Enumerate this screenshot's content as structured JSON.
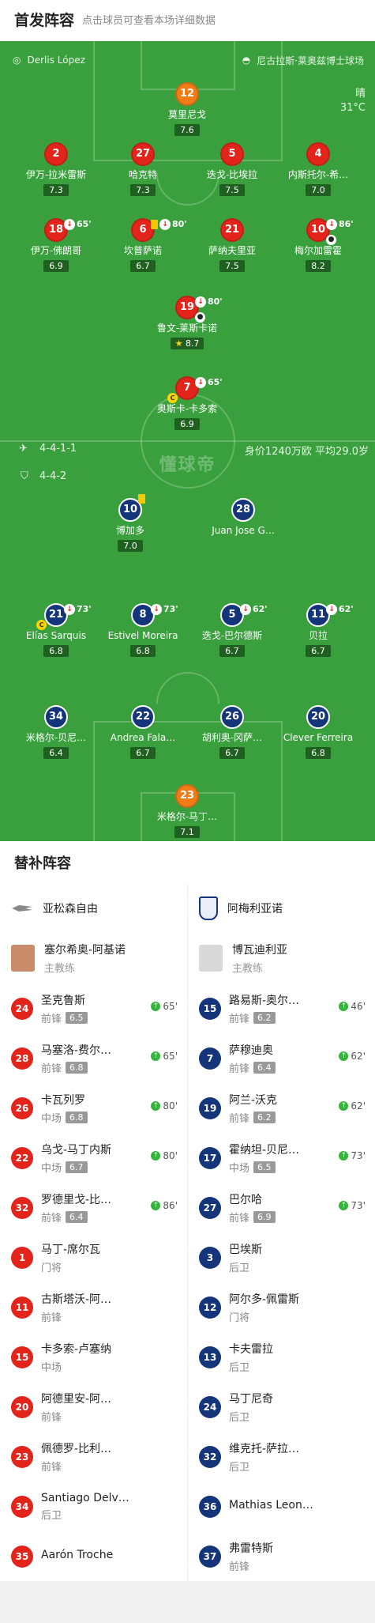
{
  "header": {
    "title": "首发阵容",
    "hint": "点击球员可查看本场详细数据"
  },
  "pitch_meta": {
    "referee": "Derlis López",
    "stadium": "尼古拉斯·莱奥兹博士球场",
    "weather": "晴",
    "temperature": "31°C",
    "home_formation": "4-4-1-1",
    "away_formation": "4-4-2",
    "value_info": "身价1240万欧 平均29.0岁",
    "watermark": "懂球帝"
  },
  "home_players": [
    {
      "num": "12",
      "name": "莫里尼戈",
      "rating": "7.6",
      "color": "orange"
    },
    {
      "num": "2",
      "name": "伊万-拉米雷斯",
      "rating": "7.3",
      "color": "red"
    },
    {
      "num": "27",
      "name": "哈克特",
      "rating": "7.3",
      "color": "red"
    },
    {
      "num": "5",
      "name": "迭戈-比埃拉",
      "rating": "7.5",
      "color": "red"
    },
    {
      "num": "4",
      "name": "内斯托尔-希…",
      "rating": "7.0",
      "color": "red"
    },
    {
      "num": "18",
      "name": "伊万-佛朗哥",
      "rating": "6.9",
      "color": "red",
      "sub_time": "65'"
    },
    {
      "num": "6",
      "name": "坎普萨诺",
      "rating": "6.7",
      "color": "red",
      "sub_time": "80'"
    },
    {
      "num": "21",
      "name": "萨纳夫里亚",
      "rating": "7.5",
      "color": "red"
    },
    {
      "num": "10",
      "name": "梅尔加雷霍",
      "rating": "8.2",
      "color": "red",
      "sub_time": "86'"
    },
    {
      "num": "19",
      "name": "鲁文-莱斯卡诺",
      "rating": "8.7",
      "color": "red",
      "sub_time": "80'"
    },
    {
      "num": "7",
      "name": "奥斯卡-卡多索",
      "rating": "6.9",
      "color": "red",
      "sub_time": "65'"
    }
  ],
  "away_players": [
    {
      "num": "10",
      "name": "博加多",
      "rating": "7.0"
    },
    {
      "num": "28",
      "name": "Juan Jose G…",
      "rating": ""
    },
    {
      "num": "21",
      "name": "Elías Sarquis",
      "rating": "6.8",
      "sub_time": "73'"
    },
    {
      "num": "8",
      "name": "Estivel Moreira",
      "rating": "6.8",
      "sub_time": "73'"
    },
    {
      "num": "5",
      "name": "迭戈-巴尔德斯",
      "rating": "6.7",
      "sub_time": "62'"
    },
    {
      "num": "11",
      "name": "贝拉",
      "rating": "6.7",
      "sub_time": "62'"
    },
    {
      "num": "34",
      "name": "米格尔-贝尼…",
      "rating": "6.4"
    },
    {
      "num": "22",
      "name": "Andrea Fala…",
      "rating": "6.7"
    },
    {
      "num": "26",
      "name": "胡利奥-冈萨…",
      "rating": "6.7"
    },
    {
      "num": "20",
      "name": "Clever Ferreira",
      "rating": "6.8"
    },
    {
      "num": "23",
      "name": "米格尔-马丁…",
      "rating": "7.1",
      "color": "orange"
    }
  ],
  "subs_section": {
    "title": "替补阵容",
    "home_team": "亚松森自由",
    "away_team": "阿梅利亚诺",
    "home_coach": {
      "name": "塞尔希奥-阿基诺",
      "role": "主教练"
    },
    "away_coach": {
      "name": "博瓦迪利亚",
      "role": "主教练"
    },
    "home_subs": [
      {
        "num": "24",
        "name": "圣克鲁斯",
        "pos": "前锋",
        "rating": "6.5",
        "in": "65'"
      },
      {
        "num": "28",
        "name": "马塞洛-费尔…",
        "pos": "前锋",
        "rating": "6.8",
        "in": "65'"
      },
      {
        "num": "26",
        "name": "卡瓦列罗",
        "pos": "中场",
        "rating": "6.8",
        "in": "80'"
      },
      {
        "num": "22",
        "name": "乌戈-马丁内斯",
        "pos": "中场",
        "rating": "6.7",
        "in": "80'"
      },
      {
        "num": "32",
        "name": "罗德里戈-比…",
        "pos": "前锋",
        "rating": "6.4",
        "in": "86'"
      },
      {
        "num": "1",
        "name": "马丁-席尔瓦",
        "pos": "门将"
      },
      {
        "num": "11",
        "name": "古斯塔沃-阿…",
        "pos": "前锋"
      },
      {
        "num": "15",
        "name": "卡多索-卢塞纳",
        "pos": "中场"
      },
      {
        "num": "20",
        "name": "阿德里安-阿…",
        "pos": "前锋"
      },
      {
        "num": "23",
        "name": "佩德罗-比利…",
        "pos": "前锋"
      },
      {
        "num": "34",
        "name": "Santiago Delv…",
        "pos": "后卫"
      },
      {
        "num": "35",
        "name": "Aarón Troche",
        "pos": ""
      }
    ],
    "away_subs": [
      {
        "num": "15",
        "name": "路易斯-奥尔…",
        "pos": "前锋",
        "rating": "6.2",
        "in": "46'"
      },
      {
        "num": "7",
        "name": "萨穆迪奥",
        "pos": "前锋",
        "rating": "6.4",
        "in": "62'"
      },
      {
        "num": "19",
        "name": "阿兰-沃克",
        "pos": "前锋",
        "rating": "6.2",
        "in": "62'"
      },
      {
        "num": "17",
        "name": "霍纳坦-贝尼…",
        "pos": "中场",
        "rating": "6.5",
        "in": "73'"
      },
      {
        "num": "27",
        "name": "巴尔哈",
        "pos": "前锋",
        "rating": "6.9",
        "in": "73'"
      },
      {
        "num": "3",
        "name": "巴埃斯",
        "pos": "后卫"
      },
      {
        "num": "12",
        "name": "阿尔多-佩雷斯",
        "pos": "门将"
      },
      {
        "num": "13",
        "name": "卡夫雷拉",
        "pos": "后卫"
      },
      {
        "num": "24",
        "name": "马丁尼奇",
        "pos": "后卫"
      },
      {
        "num": "32",
        "name": "维克托-萨拉…",
        "pos": "后卫"
      },
      {
        "num": "36",
        "name": "Mathias Leon…",
        "pos": ""
      },
      {
        "num": "37",
        "name": "弗雷特斯",
        "pos": "前锋"
      }
    ]
  }
}
